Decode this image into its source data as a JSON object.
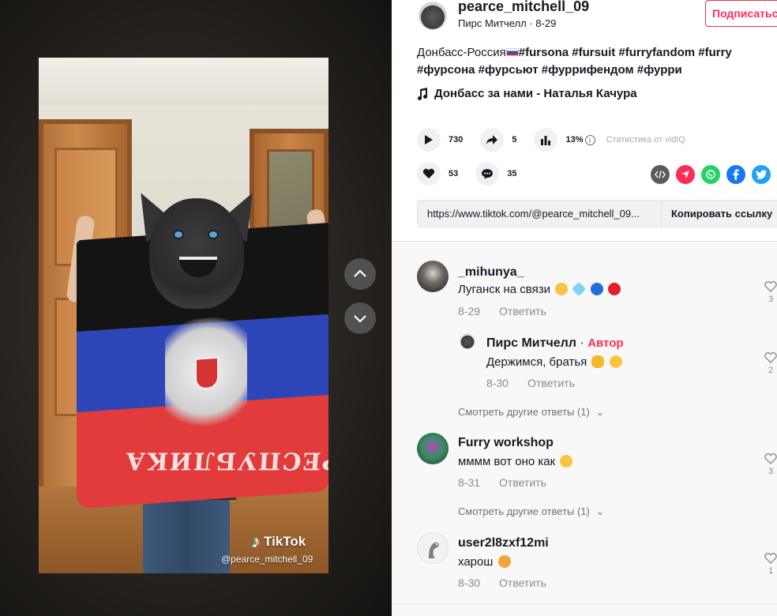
{
  "video": {
    "watermark_logo": "TikTok",
    "watermark_handle": "@pearce_mitchell_09",
    "flag_text": "РЕСПУБЛИКА"
  },
  "author": {
    "username": "pearce_mitchell_09",
    "display_meta": "Пирс Митчелл · 8-29",
    "follow_label": "Подписаться"
  },
  "description": {
    "text": "Донбасс-Россия",
    "tags_line1": "#fursona #fursuit #furryfandom #furry",
    "tags_line2": "#фурсона #фурсьют #фуррифендом #фурри"
  },
  "music": {
    "label": "Донбасс за нами - Наталья Качура"
  },
  "stats": {
    "plays": "730",
    "shares": "5",
    "ratio": "13%",
    "vidiq_label": "Статистика от vidIQ",
    "likes": "53",
    "comments": "35"
  },
  "share_icons": [
    "embed-icon",
    "send-icon",
    "whatsapp-icon",
    "facebook-icon",
    "twitter-icon"
  ],
  "link": {
    "url": "https://www.tiktok.com/@pearce_mitchell_09...",
    "copy_label": "Копировать ссылку"
  },
  "comments": [
    {
      "name": "_mihunya_",
      "text": "Луганск на связи",
      "date": "8-29",
      "reply": "Ответить",
      "likes": "3"
    },
    {
      "name": "Пирс Митчелл",
      "name_suffix": " · ",
      "author_badge": "Автор",
      "text": "Держимся, братья",
      "date": "8-30",
      "reply": "Ответить",
      "likes": "2"
    },
    {
      "name": "Furry workshop",
      "text": "мммм вот оно как",
      "date": "8-31",
      "reply": "Ответить",
      "likes": "3"
    },
    {
      "name": "user2l8zxf12mi",
      "text": "харош",
      "date": "8-30",
      "reply": "Ответить",
      "likes": "1"
    }
  ],
  "more_replies_1": "Смотреть другие ответы (1)",
  "more_replies_2": "Смотреть другие ответы (1)",
  "colors": {
    "accent": "#fe2c55",
    "blue": "#1da1f2",
    "whatsapp": "#25d366",
    "facebook": "#1877f2"
  }
}
